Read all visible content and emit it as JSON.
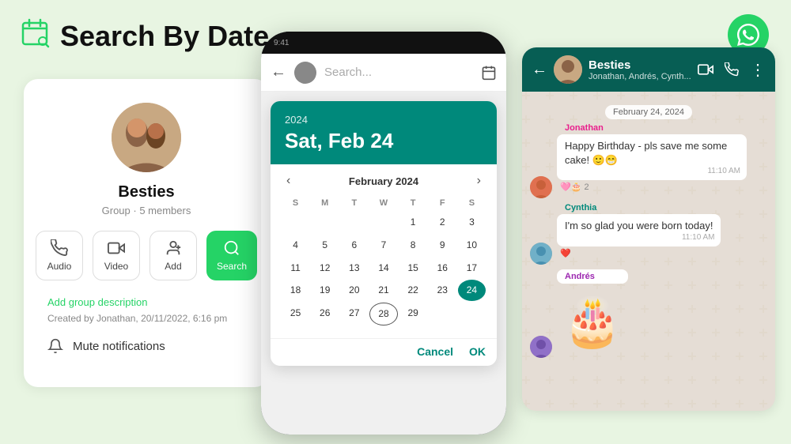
{
  "header": {
    "title": "Search By Date",
    "icon": "calendar-search-icon"
  },
  "left_panel": {
    "group_name": "Besties",
    "group_subtitle": "Group · 5 members",
    "actions": [
      {
        "label": "Audio",
        "icon": "phone-icon"
      },
      {
        "label": "Video",
        "icon": "video-icon"
      },
      {
        "label": "Add",
        "icon": "add-person-icon"
      },
      {
        "label": "Search",
        "icon": "search-icon",
        "active": true
      }
    ],
    "add_description": "Add group description",
    "created_text": "Created by Jonathan, 20/11/2022, 6:16 pm",
    "mute_label": "Mute notifications"
  },
  "middle_panel": {
    "search_placeholder": "Search...",
    "calendar": {
      "year": "2024",
      "date_display": "Sat, Feb 24",
      "month_label": "February 2024",
      "day_headers": [
        "S",
        "M",
        "T",
        "W",
        "T",
        "F",
        "S"
      ],
      "days": [
        {
          "day": "",
          "empty": true
        },
        {
          "day": "",
          "empty": true
        },
        {
          "day": "",
          "empty": true
        },
        {
          "day": "",
          "empty": true
        },
        {
          "day": "1"
        },
        {
          "day": "2"
        },
        {
          "day": "3"
        },
        {
          "day": "4"
        },
        {
          "day": "5"
        },
        {
          "day": "6"
        },
        {
          "day": "7"
        },
        {
          "day": "8"
        },
        {
          "day": "9"
        },
        {
          "day": "10"
        },
        {
          "day": "11"
        },
        {
          "day": "12"
        },
        {
          "day": "13"
        },
        {
          "day": "14"
        },
        {
          "day": "15"
        },
        {
          "day": "16"
        },
        {
          "day": "17"
        },
        {
          "day": "18"
        },
        {
          "day": "19"
        },
        {
          "day": "20"
        },
        {
          "day": "21"
        },
        {
          "day": "22"
        },
        {
          "day": "23"
        },
        {
          "day": "24",
          "selected": true
        },
        {
          "day": "25"
        },
        {
          "day": "26"
        },
        {
          "day": "27"
        },
        {
          "day": "28",
          "today": true
        },
        {
          "day": "29"
        }
      ],
      "cancel_label": "Cancel",
      "ok_label": "OK"
    }
  },
  "right_panel": {
    "chat_name": "Besties",
    "chat_members": "Jonathan, Andrés, Cynth...",
    "date_badge": "February 24, 2024",
    "messages": [
      {
        "sender": "Jonathan",
        "sender_color": "jonathan",
        "text": "Happy Birthday - pls save me some cake! 🙂😁",
        "time": "11:10 AM",
        "reactions": "🩷🎂 2"
      },
      {
        "sender": "Cynthia",
        "sender_color": "cynthia",
        "text": "I'm so glad you were born today!",
        "time": "11:10 AM",
        "reactions": "❤️"
      },
      {
        "sender": "Andrés",
        "sender_color": "andres",
        "sticker": "🎂🕯️"
      }
    ]
  }
}
